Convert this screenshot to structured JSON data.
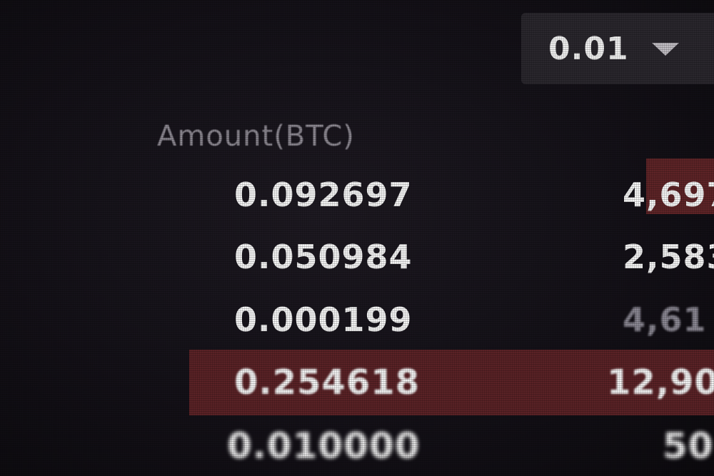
{
  "precision": {
    "value": "0.01",
    "arrow_icon": "triangle-down-icon"
  },
  "header": {
    "amount_label": "Amount(BTC)"
  },
  "rows": [
    {
      "amount": "0.092697",
      "total": "4,697"
    },
    {
      "amount": "0.050984",
      "total": "2,583"
    },
    {
      "amount": "0.000199",
      "total": "4,61"
    },
    {
      "amount": "0.254618",
      "total": "12,90",
      "highlighted": true
    },
    {
      "amount": "0.010000",
      "total": "50"
    }
  ],
  "colors": {
    "background": "#141118",
    "highlight": "#5a2226",
    "text": "#f4f4f4",
    "header_text": "#8e8a93"
  }
}
